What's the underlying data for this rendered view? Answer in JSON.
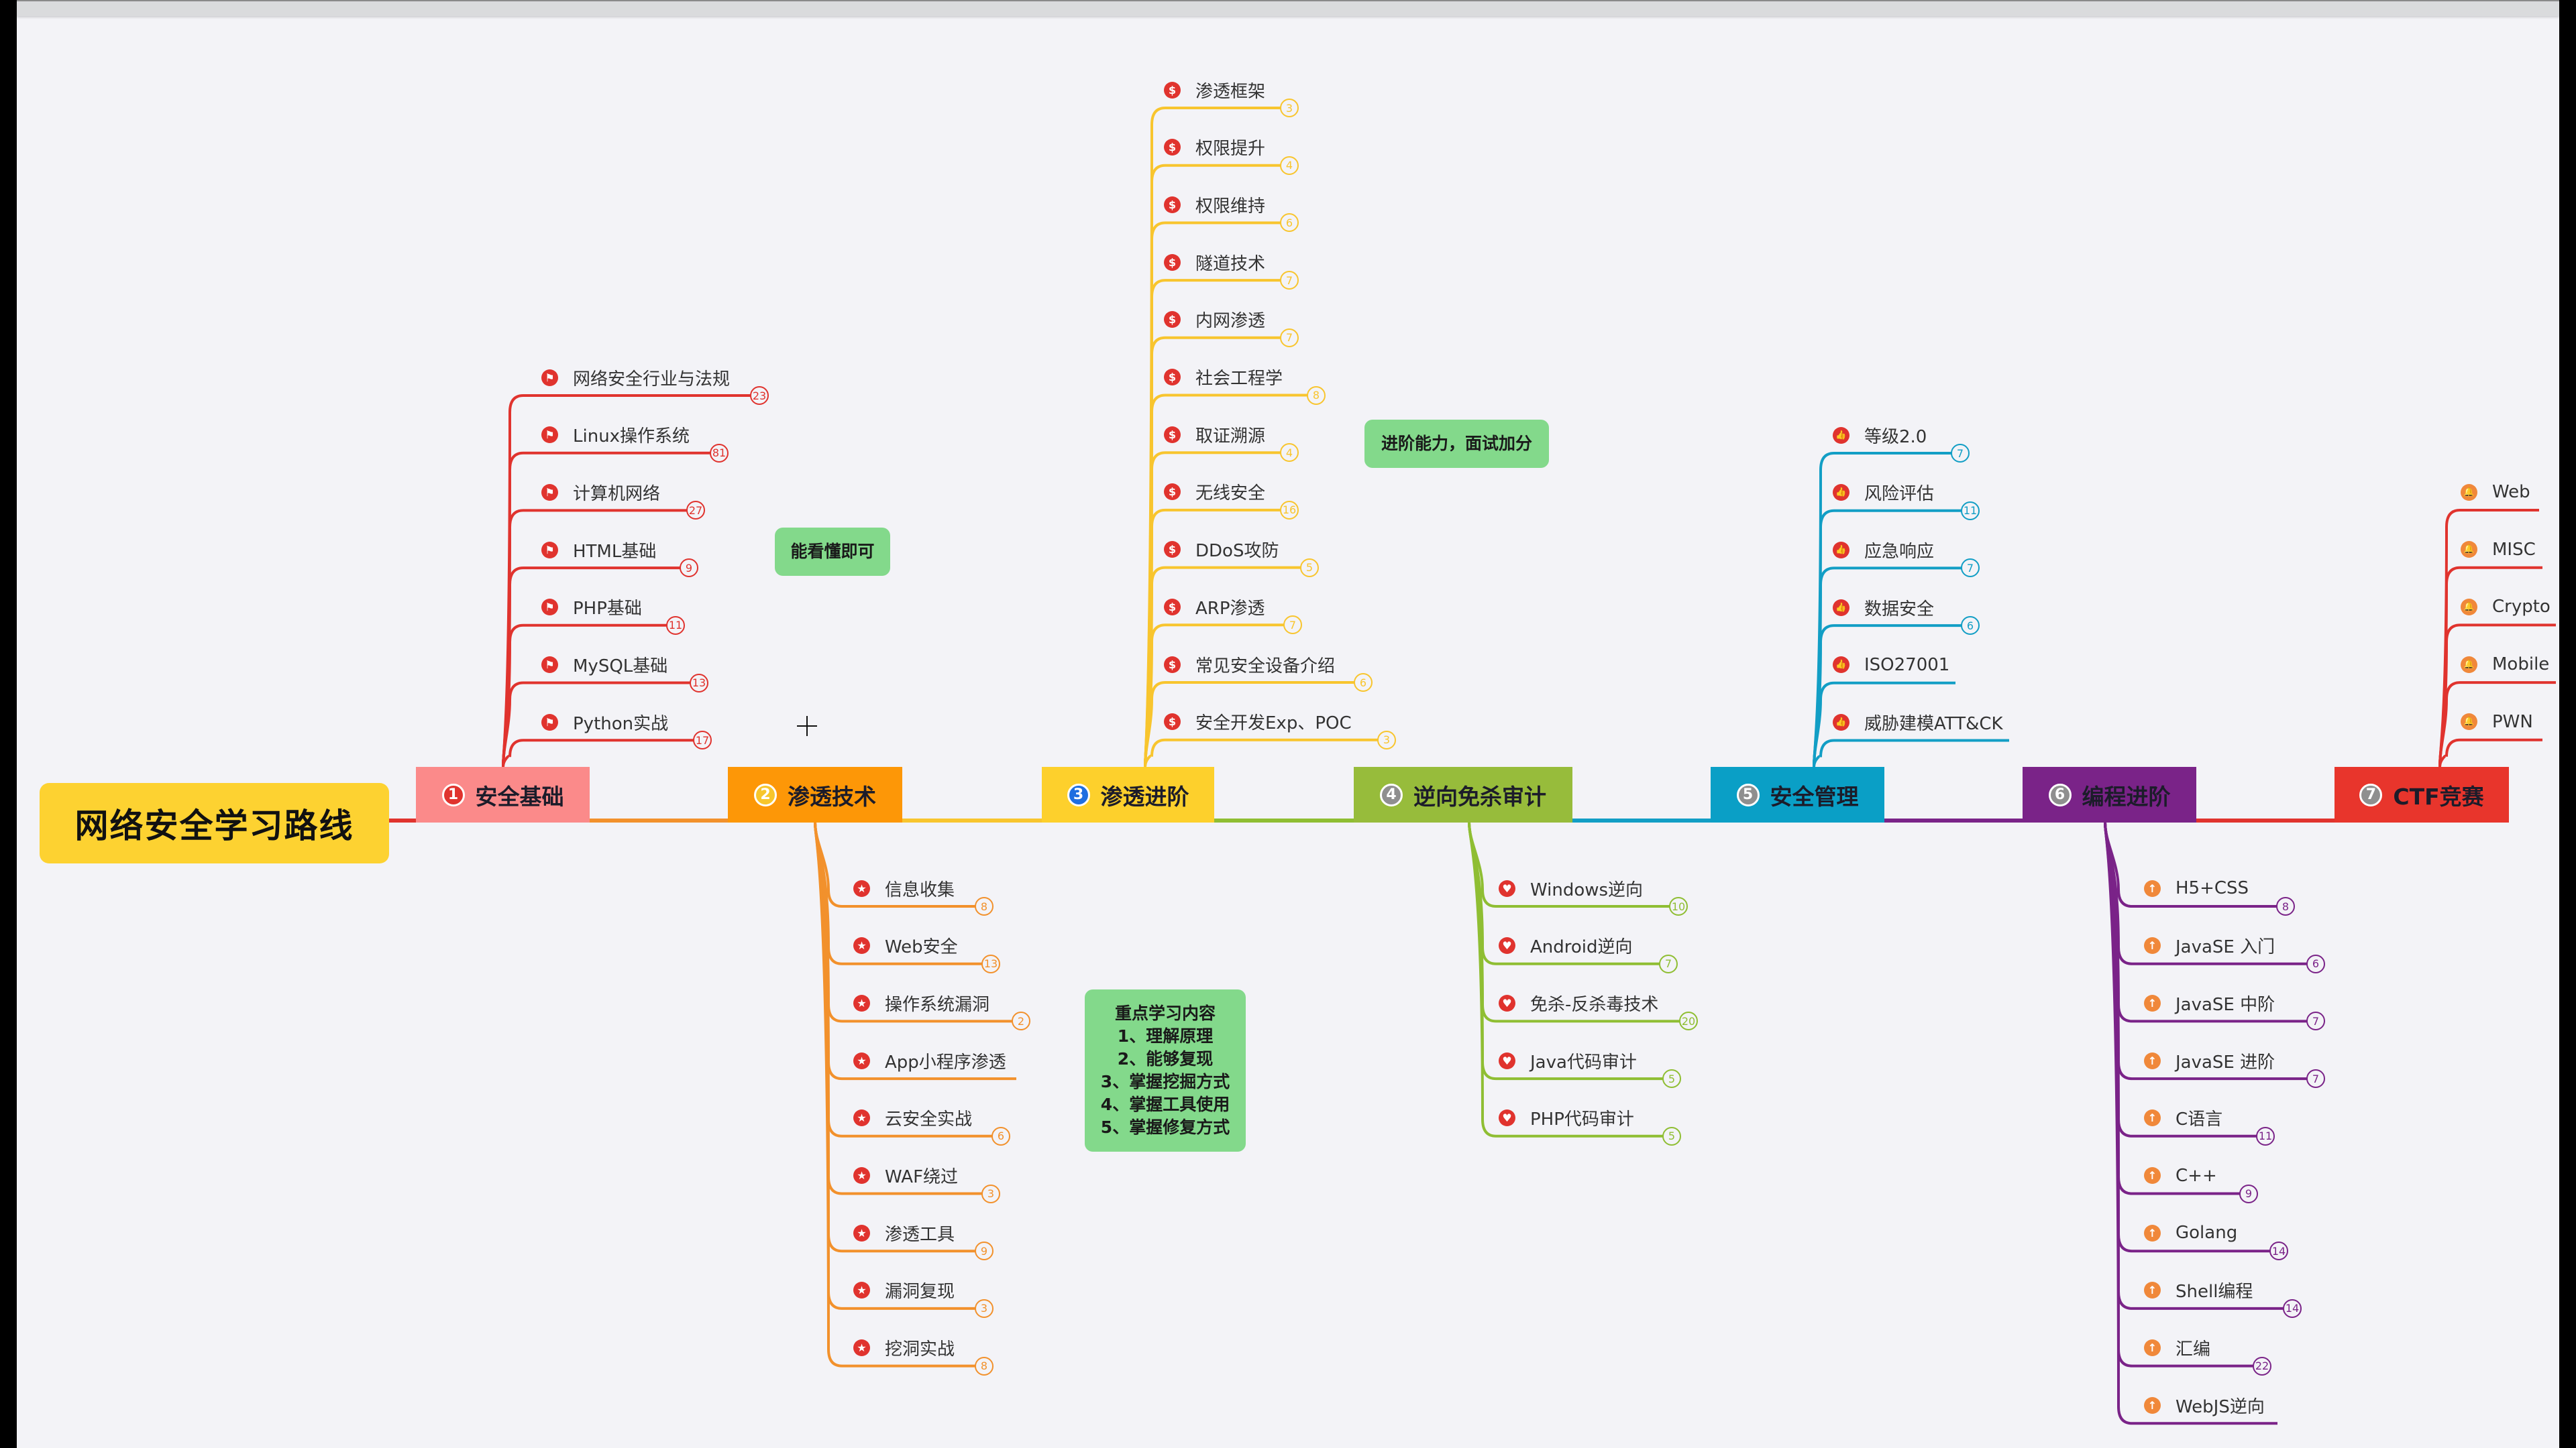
{
  "root": {
    "title": "网络安全学习路线",
    "color": "#fdd231"
  },
  "topics": [
    {
      "num": "1",
      "label": "安全基础",
      "color": "#fb8a8a",
      "line": "#e0332e",
      "num_bg": "#e0332e",
      "icon": "flag-icon",
      "icon_color": "#e0332e",
      "dir": "up",
      "items": [
        {
          "label": "网络安全行业与法规",
          "count": "23"
        },
        {
          "label": "Linux操作系统",
          "count": "81"
        },
        {
          "label": "计算机网络",
          "count": "27"
        },
        {
          "label": "HTML基础",
          "count": "9"
        },
        {
          "label": "PHP基础",
          "count": "11"
        },
        {
          "label": "MySQL基础",
          "count": "13"
        },
        {
          "label": "Python实战",
          "count": "17"
        }
      ]
    },
    {
      "num": "2",
      "label": "渗透技术",
      "color": "#fd9707",
      "line": "#f2912c",
      "num_bg": "#f7c62c",
      "icon": "star-icon",
      "icon_color": "#e0332e",
      "dir": "down",
      "items": [
        {
          "label": "信息收集",
          "count": "8"
        },
        {
          "label": "Web安全",
          "count": "13"
        },
        {
          "label": "操作系统漏洞",
          "count": "2"
        },
        {
          "label": "App小程序渗透",
          "count": ""
        },
        {
          "label": "云安全实战",
          "count": "6"
        },
        {
          "label": "WAF绕过",
          "count": "3"
        },
        {
          "label": "渗透工具",
          "count": "9"
        },
        {
          "label": "漏洞复现",
          "count": "3"
        },
        {
          "label": "挖洞实战",
          "count": "8"
        }
      ]
    },
    {
      "num": "3",
      "label": "渗透进阶",
      "color": "#fdd02c",
      "line": "#f8c52e",
      "num_bg": "#1f6fe0",
      "icon": "dollar-icon",
      "icon_color": "#e0332e",
      "dir": "up",
      "items": [
        {
          "label": "渗透框架",
          "count": "3"
        },
        {
          "label": "权限提升",
          "count": "4"
        },
        {
          "label": "权限维持",
          "count": "6"
        },
        {
          "label": "隧道技术",
          "count": "7"
        },
        {
          "label": "内网渗透",
          "count": "7"
        },
        {
          "label": "社会工程学",
          "count": "8"
        },
        {
          "label": "取证溯源",
          "count": "4"
        },
        {
          "label": "无线安全",
          "count": "16"
        },
        {
          "label": "DDoS攻防",
          "count": "5"
        },
        {
          "label": "ARP渗透",
          "count": "7"
        },
        {
          "label": "常见安全设备介绍",
          "count": "6"
        },
        {
          "label": "安全开发Exp、POC",
          "count": "3"
        }
      ]
    },
    {
      "num": "4",
      "label": "逆向免杀审计",
      "color": "#97bc3b",
      "line": "#8fbe33",
      "num_bg": "#8f8f8f",
      "icon": "heart-icon",
      "icon_color": "#e0332e",
      "dir": "down",
      "items": [
        {
          "label": "Windows逆向",
          "count": "10"
        },
        {
          "label": "Android逆向",
          "count": "7"
        },
        {
          "label": "免杀-反杀毒技术",
          "count": "20"
        },
        {
          "label": "Java代码审计",
          "count": "5"
        },
        {
          "label": "PHP代码审计",
          "count": "5"
        }
      ]
    },
    {
      "num": "5",
      "label": "安全管理",
      "color": "#0a9fc6",
      "line": "#129ec5",
      "num_bg": "#8f8f8f",
      "icon": "thumbs-up-icon",
      "icon_color": "#e0332e",
      "dir": "up",
      "items": [
        {
          "label": "等级2.0",
          "count": "7"
        },
        {
          "label": "风险评估",
          "count": "11"
        },
        {
          "label": "应急响应",
          "count": "7"
        },
        {
          "label": "数据安全",
          "count": "6"
        },
        {
          "label": "ISO27001",
          "count": ""
        },
        {
          "label": "威胁建模ATT&CK",
          "count": ""
        }
      ]
    },
    {
      "num": "6",
      "label": "编程进阶",
      "color": "#7a2388",
      "line": "#7a2388",
      "num_bg": "#8f8f8f",
      "icon": "arrow-up-icon",
      "icon_color": "#f0883a",
      "dir": "down",
      "items": [
        {
          "label": "H5+CSS",
          "count": "8"
        },
        {
          "label": "JavaSE 入门",
          "count": "6"
        },
        {
          "label": "JavaSE 中阶",
          "count": "7"
        },
        {
          "label": "JavaSE 进阶",
          "count": "7"
        },
        {
          "label": "C语言",
          "count": "11"
        },
        {
          "label": "C++",
          "count": "9"
        },
        {
          "label": "Golang",
          "count": "14"
        },
        {
          "label": "Shell编程",
          "count": "14"
        },
        {
          "label": "汇编",
          "count": "22"
        },
        {
          "label": "WebJS逆向",
          "count": ""
        }
      ]
    },
    {
      "num": "7",
      "label": "CTF竞赛",
      "color": "#e8352c",
      "line": "#e0332e",
      "num_bg": "#8f8f8f",
      "icon": "bell-icon",
      "icon_color": "#f0883a",
      "dir": "up",
      "items": [
        {
          "label": "Web",
          "count": ""
        },
        {
          "label": "MISC",
          "count": ""
        },
        {
          "label": "Crypto",
          "count": ""
        },
        {
          "label": "Mobile",
          "count": ""
        },
        {
          "label": "PWN",
          "count": ""
        }
      ]
    }
  ],
  "notes": {
    "basics": "能看懂即可",
    "advanced": "进阶能力，面试加分",
    "key_points": [
      "重点学习内容",
      "1、理解原理",
      "2、能够复现",
      "3、掌握挖掘方式",
      "4、掌握工具使用",
      "5、掌握修复方式"
    ]
  }
}
